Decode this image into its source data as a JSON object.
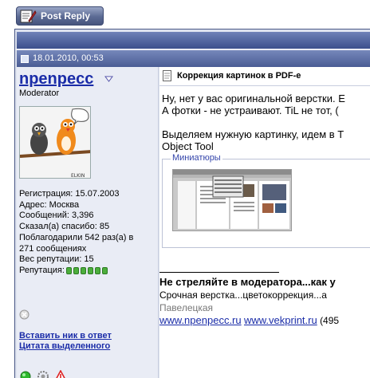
{
  "toolbar": {
    "post_reply_label": "Post Reply"
  },
  "post": {
    "date": "18.01.2010, 00:53",
    "title": "Коррекция картинок в PDF-е",
    "body_lines": [
      "Ну, нет у вас оригинальной верстки. Е",
      "А фотки - не устраивают. TiL не тот, (",
      "",
      "Выделяем нужную картинку, идем в Т",
      "Object Tool"
    ],
    "attachment_legend": "Миниатюры"
  },
  "user": {
    "name": "npenpecc",
    "role": "Moderator",
    "stats": [
      "Регистрация: 15.07.2003",
      "Адрес: Москва",
      "Сообщений: 3,396",
      "Сказал(а) спасибо: 85",
      "Поблагодарили 542 раз(а) в",
      "271 сообщениях",
      "Вес репутации: 15"
    ],
    "reputation_label": "Репутация:",
    "reputation_pips": 6,
    "links": [
      "Вставить ник в ответ",
      "Цитата выделенного"
    ],
    "avatar_caption": "ELKIN"
  },
  "signature": {
    "line1": "Не стреляйте в модератора...как у",
    "line2": "Срочная верстка...цветокоррекция...а",
    "line3": "Павелецкая",
    "link1": "www.npenpecc.ru",
    "link2": "www.vekprint.ru",
    "tail": "(495"
  },
  "colors": {
    "link": "#1a2ca8",
    "header": "#4a5c94",
    "panel": "#e9ecf5"
  }
}
